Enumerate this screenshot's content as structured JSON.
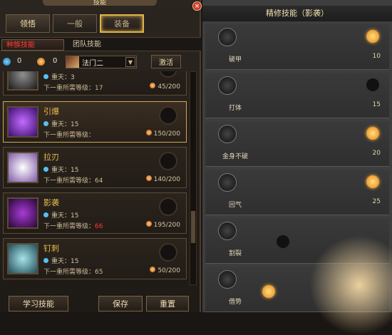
{
  "window": {
    "title": "技能",
    "close_label": "×"
  },
  "tabs": [
    {
      "label": "领悟",
      "active": true
    },
    {
      "label": "一般"
    },
    {
      "label": "装备",
      "highlight": true
    }
  ],
  "subtabs": [
    "种族技能",
    "团队技能"
  ],
  "resources": {
    "points_blue": "0",
    "points_orange": "0",
    "selector": "法门二",
    "activate_label": "激活"
  },
  "skills": [
    {
      "name": "",
      "level_line": "重天：3",
      "req_line": "下一重所需等级：17",
      "req_red": false,
      "count": "45/200",
      "color": "#2c2c2c"
    },
    {
      "name": "引爆",
      "level_line": "重天：15",
      "req_line": "下一重所需等级：",
      "req_red": false,
      "count": "150/200",
      "color": "#6b2bbf",
      "selected": true
    },
    {
      "name": "拉刃",
      "level_line": "重天：15",
      "req_line": "下一重所需等级：64",
      "req_red": false,
      "count": "140/200",
      "color": "#c59de8"
    },
    {
      "name": "影袭",
      "level_line": "重天：15",
      "req_line": "下一重所需等级：",
      "req_value": "66",
      "req_red": true,
      "count": "195/200",
      "color": "#6a1a8d"
    },
    {
      "name": "钉刺",
      "level_line": "重天：15",
      "req_line": "下一重所需等级：65",
      "req_red": false,
      "count": "50/200",
      "color": "#3f7f86"
    }
  ],
  "buttons": {
    "learn": "学习技能",
    "save": "保存",
    "reset": "重置"
  },
  "right": {
    "title": "精修技能（影袭）",
    "rows": [
      {
        "name": "破甲",
        "value": "10",
        "active": true
      },
      {
        "name": "打体",
        "value": "15",
        "active": false
      },
      {
        "name": "金身不破",
        "value": "20",
        "active": true
      },
      {
        "name": "回气",
        "value": "25",
        "active": true
      },
      {
        "name": "割裂",
        "value": "",
        "active": false
      },
      {
        "name": "借势",
        "value": "",
        "active": true
      }
    ]
  },
  "colors": {
    "accent": "#e1b24a",
    "red": "#ff3a2f",
    "orange": "#e6801b"
  }
}
